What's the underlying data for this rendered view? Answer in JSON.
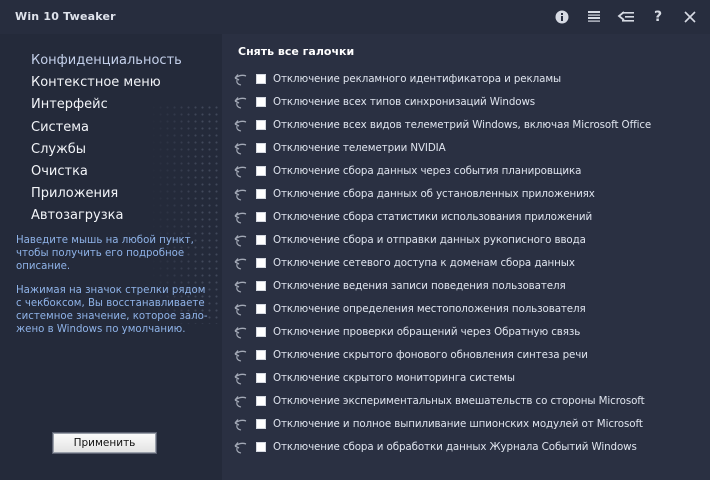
{
  "app": {
    "title": "Win 10 Tweaker"
  },
  "title_icons": [
    "info-icon",
    "hamburger-icon",
    "back-list-icon",
    "help-icon",
    "close-icon"
  ],
  "title_icon_glyphs": {
    "help": "?"
  },
  "sidebar": {
    "items": [
      {
        "label": "Конфиденциальность",
        "active": true
      },
      {
        "label": "Контекстное меню"
      },
      {
        "label": "Интерфейс"
      },
      {
        "label": "Система"
      },
      {
        "label": "Службы"
      },
      {
        "label": "Очистка"
      },
      {
        "label": "Приложения"
      },
      {
        "label": "Автозагрузка"
      }
    ],
    "hint1": "Наведите мышь на любой пункт, чтобы получить его подробное описание.",
    "hint2": "Нажимая на значок стрелки рядом с чекбоксом, Вы восстанавливаете системное значение, которое зало-жено в Windows по умолчанию.",
    "apply_label": "Применить"
  },
  "main": {
    "uncheck_all": "Снять все галочки",
    "options": [
      {
        "label": "Отключение рекламного идентификатора и рекламы",
        "checked": false
      },
      {
        "label": "Отключение всех типов синхронизаций Windows",
        "checked": false
      },
      {
        "label": "Отключение всех видов телеметрий Windows, включая Microsoft Office",
        "checked": false
      },
      {
        "label": "Отключение телеметрии NVIDIA",
        "checked": false
      },
      {
        "label": "Отключение сбора данных через события планировщика",
        "checked": false
      },
      {
        "label": "Отключение сбора данных об установленных приложениях",
        "checked": false
      },
      {
        "label": "Отключение сбора статистики использования приложений",
        "checked": false
      },
      {
        "label": "Отключение сбора и отправки данных рукописного ввода",
        "checked": false
      },
      {
        "label": "Отключение сетевого доступа к доменам сбора данных",
        "checked": false
      },
      {
        "label": "Отключение ведения записи поведения пользователя",
        "checked": false
      },
      {
        "label": "Отключение определения местоположения пользователя",
        "checked": false
      },
      {
        "label": "Отключение проверки обращений через Обратную связь",
        "checked": false
      },
      {
        "label": "Отключение скрытого фонового обновления синтеза речи",
        "checked": false
      },
      {
        "label": "Отключение скрытого мониторинга системы",
        "checked": false
      },
      {
        "label": "Отключение экспериментальных вмешательств со стороны Microsoft",
        "checked": false
      },
      {
        "label": "Отключение и полное выпиливание шпионских модулей от Microsoft",
        "checked": false
      },
      {
        "label": "Отключение сбора и обработки данных Журнала Событий Windows",
        "checked": false
      }
    ]
  },
  "colors": {
    "background": "#2a3042",
    "sidebar": "#242a3a",
    "hint_text": "#8fb3e8",
    "nav_active": "#c4d0ea"
  }
}
